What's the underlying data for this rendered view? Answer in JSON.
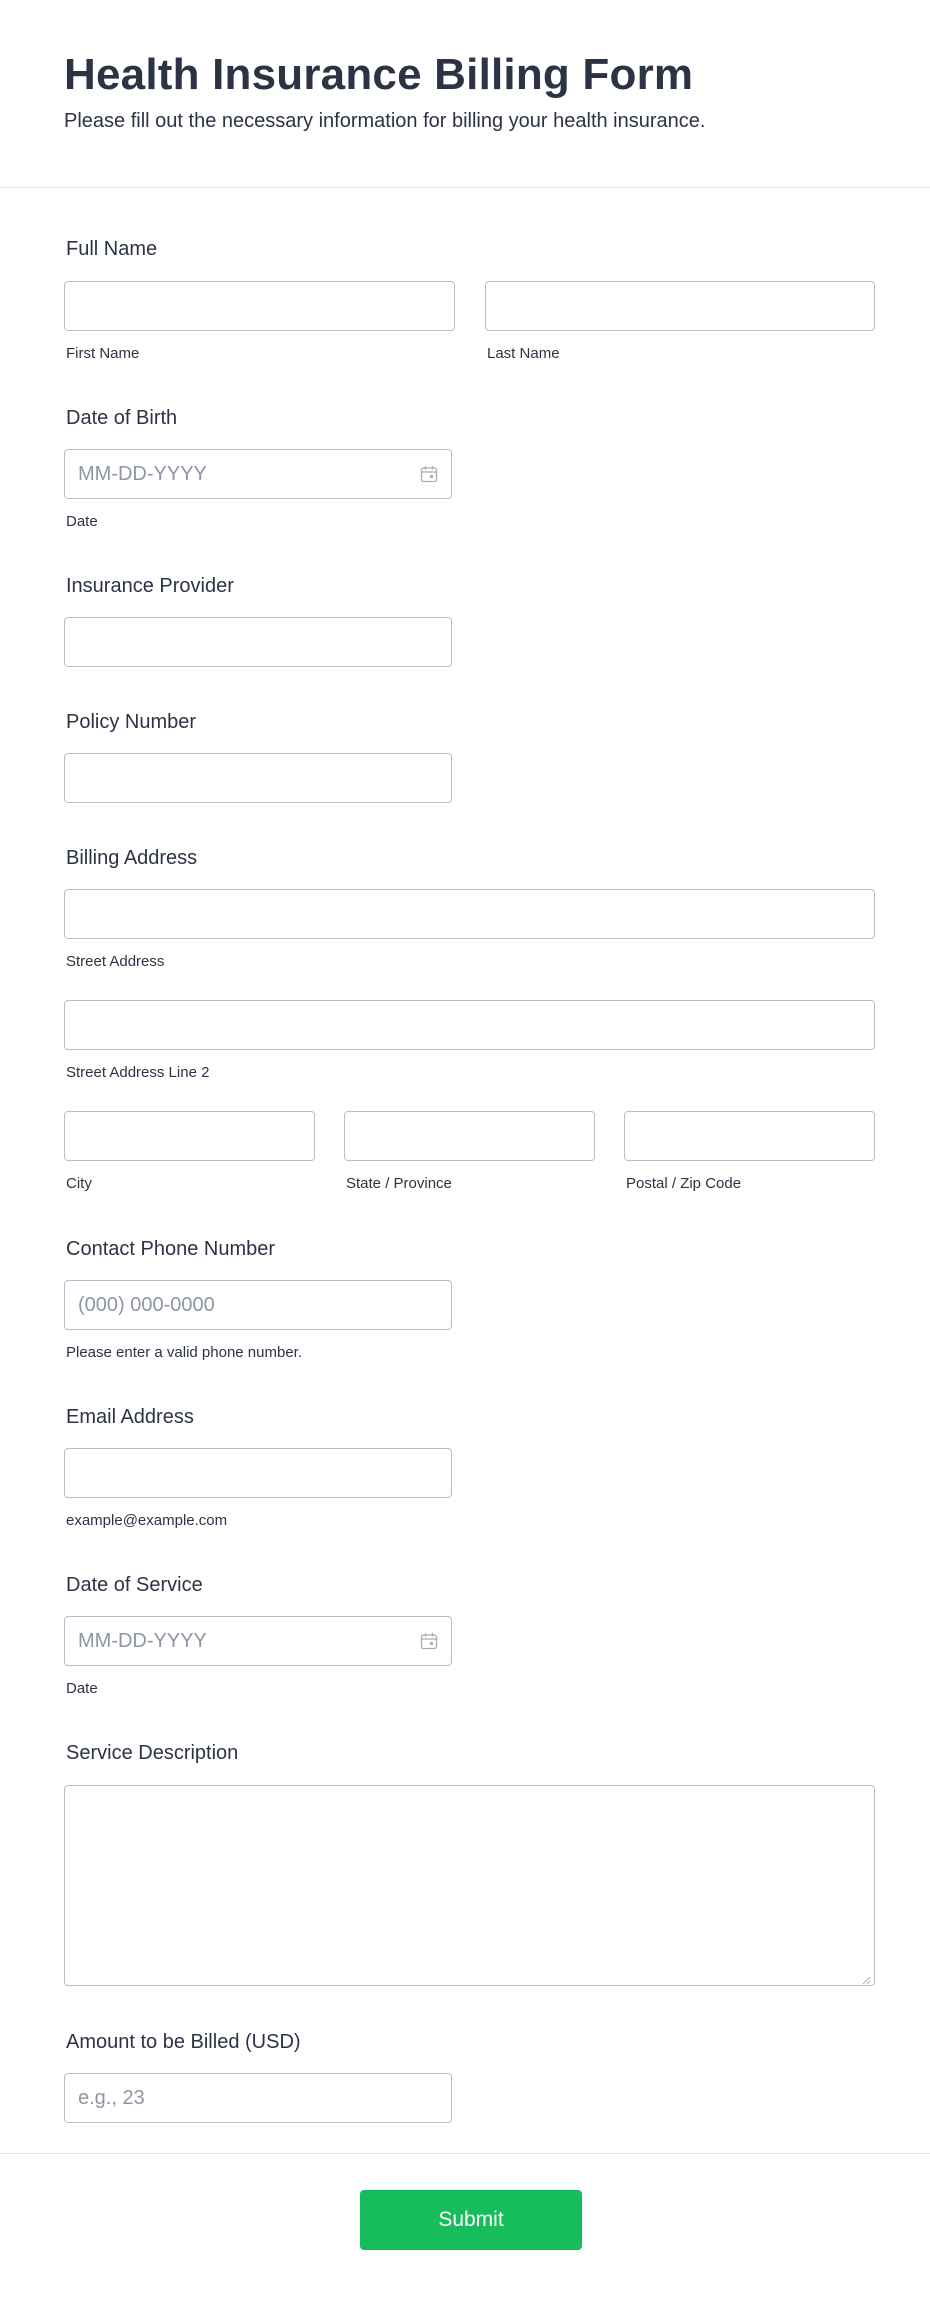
{
  "header": {
    "title": "Health Insurance Billing Form",
    "subtitle": "Please fill out the necessary information for billing your health insurance."
  },
  "full_name": {
    "label": "Full Name",
    "first_sublabel": "First Name",
    "last_sublabel": "Last Name"
  },
  "dob": {
    "label": "Date of Birth",
    "placeholder": "MM-DD-YYYY",
    "sublabel": "Date",
    "icon": "calendar-icon"
  },
  "insurance_provider": {
    "label": "Insurance Provider"
  },
  "policy_number": {
    "label": "Policy Number"
  },
  "billing_address": {
    "label": "Billing Address",
    "street_sublabel": "Street Address",
    "street2_sublabel": "Street Address Line 2",
    "city_sublabel": "City",
    "state_sublabel": "State / Province",
    "zip_sublabel": "Postal / Zip Code"
  },
  "phone": {
    "label": "Contact Phone Number",
    "placeholder": "(000) 000-0000",
    "sublabel": "Please enter a valid phone number."
  },
  "email": {
    "label": "Email Address",
    "sublabel": "example@example.com"
  },
  "date_of_service": {
    "label": "Date of Service",
    "placeholder": "MM-DD-YYYY",
    "sublabel": "Date",
    "icon": "calendar-icon"
  },
  "service_description": {
    "label": "Service Description"
  },
  "amount": {
    "label": "Amount to be Billed (USD)",
    "placeholder": "e.g., 23"
  },
  "footer": {
    "submit_label": "Submit"
  },
  "colors": {
    "text": "#2c3345",
    "border": "#b8bdc9",
    "placeholder": "#8f96a3",
    "submit": "#18bd5b"
  }
}
